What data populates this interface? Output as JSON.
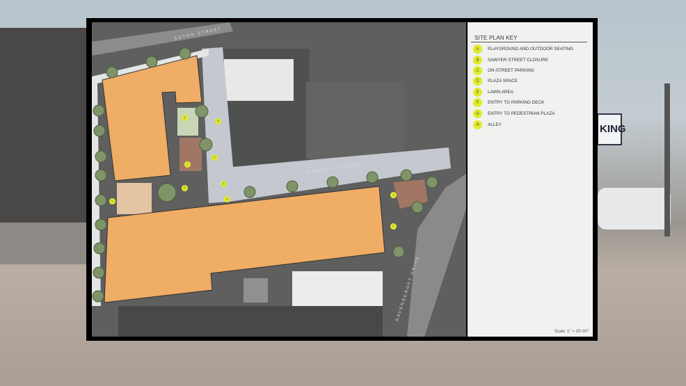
{
  "background": {
    "sign_text": "KING"
  },
  "site_plan": {
    "streets": {
      "aston": "ASTON STREET",
      "sawyer": "SAWYER STREET",
      "ravenscroft": "RAVENSCROFT DRIVE"
    },
    "key": {
      "title": "SITE PLAN KEY",
      "items": [
        {
          "letter": "A",
          "label": "PLAYGROUND AND OUTDOOR SEATING"
        },
        {
          "letter": "B",
          "label": "SAWYER STREET CLOSURE"
        },
        {
          "letter": "C",
          "label": "ON-STREET PARKING"
        },
        {
          "letter": "D",
          "label": "PLAZA SPACE"
        },
        {
          "letter": "E",
          "label": "LAWN AREA"
        },
        {
          "letter": "F",
          "label": "ENTRY TO PARKING DECK"
        },
        {
          "letter": "G",
          "label": "ENTRY TO PEDESTRIAN PLAZA"
        },
        {
          "letter": "H",
          "label": "ALLEY"
        }
      ],
      "scale": "Scale: 1\" = 20'-00\""
    },
    "markers": [
      "E",
      "B",
      "C",
      "A",
      "D",
      "B",
      "G",
      "A",
      "F",
      "H"
    ],
    "colors": {
      "building": "#efad65",
      "marker": "#e2ea2a",
      "road": "#c5c9cf",
      "panel": "#f1f1f0"
    }
  }
}
